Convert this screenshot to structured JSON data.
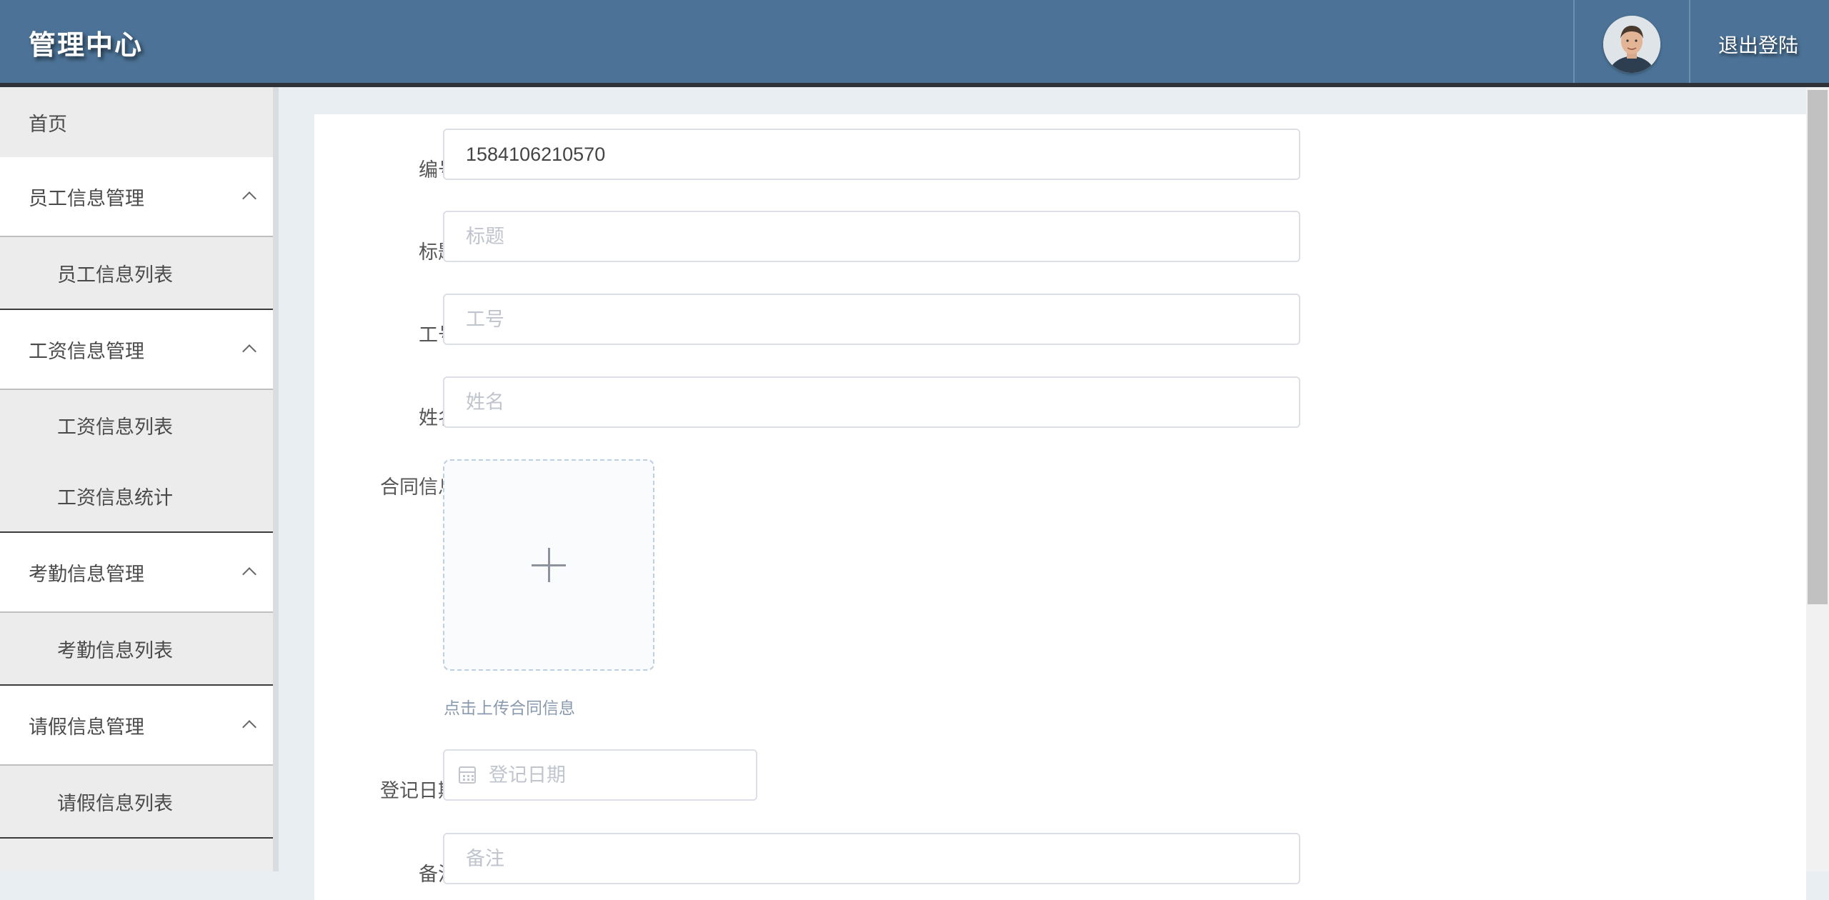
{
  "header": {
    "title": "管理中心",
    "logout_label": "退出登陆"
  },
  "sidebar": {
    "home_label": "首页",
    "groups": [
      {
        "label": "员工信息管理",
        "items": [
          {
            "label": "员工信息列表"
          }
        ]
      },
      {
        "label": "工资信息管理",
        "items": [
          {
            "label": "工资信息列表"
          },
          {
            "label": "工资信息统计"
          }
        ]
      },
      {
        "label": "考勤信息管理",
        "items": [
          {
            "label": "考勤信息列表"
          }
        ]
      },
      {
        "label": "请假信息管理",
        "items": [
          {
            "label": "请假信息列表"
          }
        ]
      }
    ]
  },
  "form": {
    "number": {
      "label": "编号",
      "value": "1584106210570"
    },
    "title": {
      "label": "标题",
      "placeholder": "标题",
      "value": ""
    },
    "employee_no": {
      "label": "工号",
      "placeholder": "工号",
      "value": ""
    },
    "name": {
      "label": "姓名",
      "placeholder": "姓名",
      "value": ""
    },
    "contract": {
      "label": "合同信息",
      "hint": "点击上传合同信息"
    },
    "register_date": {
      "label": "登记日期",
      "placeholder": "登记日期"
    },
    "remark": {
      "label": "备注",
      "placeholder": "备注"
    }
  },
  "icons": {
    "header_avatar": "avatar",
    "menu_toggle": "chevron-up-icon",
    "upload": "plus-icon",
    "date": "calendar-icon"
  },
  "colors": {
    "header_bg": "#4c7397",
    "sidebar_bg": "#ededed",
    "main_bg": "#e9eef3"
  }
}
